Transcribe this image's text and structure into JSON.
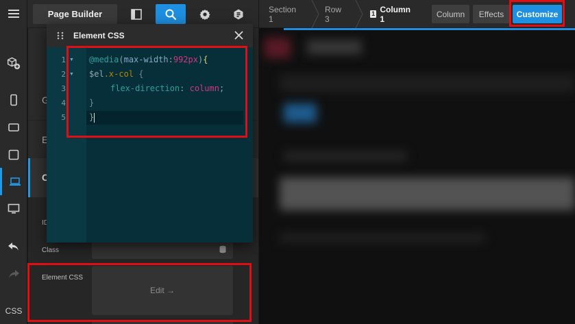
{
  "toolbar": {
    "title": "Page Builder",
    "breadcrumbs": [
      {
        "label": "Section 1"
      },
      {
        "label": "Row 3"
      },
      {
        "label": "Column 1",
        "badge": "1"
      }
    ],
    "tabs": [
      {
        "label": "Column"
      },
      {
        "label": "Effects"
      },
      {
        "label": "Customize"
      }
    ]
  },
  "rail": {
    "css_label": "CSS"
  },
  "panel": {
    "tab_labels": [
      "G",
      "E",
      "C"
    ],
    "id_label": "ID",
    "class_label": "Class",
    "element_css_label": "Element CSS",
    "edit_label": "Edit →"
  },
  "modal": {
    "title": "Element CSS",
    "line_numbers": [
      "1",
      "2",
      "3",
      "4",
      "5"
    ],
    "code": {
      "media_at": "@media",
      "media_open": "(",
      "media_feature": "max-width",
      "media_colon": ":",
      "media_value": "992px",
      "media_close": ")",
      "media_brace": "{",
      "selector_var": "$el",
      "selector_class": ".x-col",
      "selector_brace": " {",
      "property": "flex-direction",
      "colon": ": ",
      "value": "column",
      "semicolon": ";",
      "inner_close": "}",
      "outer_close": "}"
    }
  },
  "colors": {
    "accent": "#1e8fe1",
    "highlight": "#e00f16",
    "editor_bg": "#072f3a"
  },
  "icons": [
    "menu-icon",
    "cube-add-icon",
    "mobile-icon",
    "tablet-landscape-icon",
    "tablet-icon",
    "laptop-icon",
    "desktop-icon",
    "undo-icon",
    "redo-icon",
    "panel-layout-icon",
    "search-icon",
    "gear-icon",
    "badge-icon",
    "grip-icon",
    "close-icon",
    "database-icon"
  ]
}
